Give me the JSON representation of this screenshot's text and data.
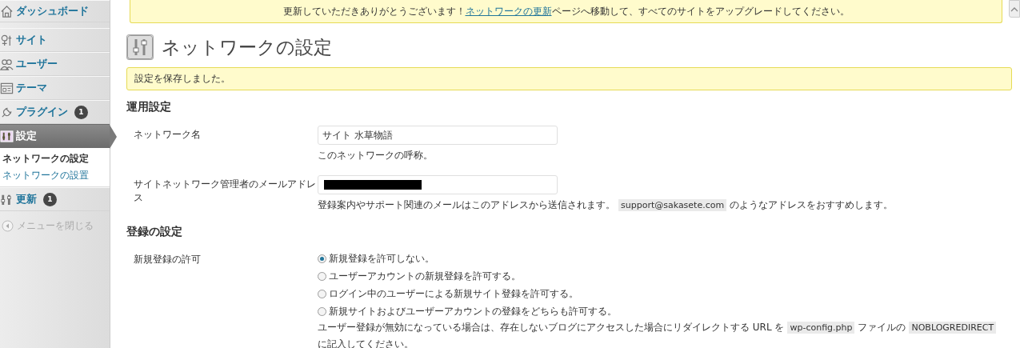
{
  "sidebar": {
    "items": [
      {
        "label": "ダッシュボード",
        "selected": false
      },
      {
        "label": "サイト",
        "selected": false
      },
      {
        "label": "ユーザー",
        "selected": false
      },
      {
        "label": "テーマ",
        "selected": false
      },
      {
        "label": "プラグイン",
        "selected": false,
        "badge": "1"
      },
      {
        "label": "設定",
        "selected": true,
        "children": [
          {
            "label": "ネットワークの設定",
            "selected": true
          },
          {
            "label": "ネットワークの設置",
            "selected": false
          }
        ]
      },
      {
        "label": "更新",
        "selected": false,
        "badge": "1"
      }
    ],
    "collapse": "メニューを閉じる"
  },
  "update_notice": {
    "before": "更新していただきありがとうございます！",
    "link": "ネットワークの更新",
    "after": "ページへ移動して、すべてのサイトをアップグレードしてください。"
  },
  "page_title": "ネットワークの設定",
  "saved_notice": "設定を保存しました。",
  "sections": [
    {
      "heading": "運用設定",
      "rows": [
        {
          "kind": "text",
          "label": "ネットワーク名",
          "value": "サイト 水草物語",
          "description": [
            {
              "kind": "text",
              "text": "このネットワークの呼称。"
            }
          ]
        },
        {
          "kind": "redacted",
          "label": "サイトネットワーク管理者のメールアドレス",
          "description": [
            {
              "kind": "text",
              "text": "登録案内やサポート関連のメールはこのアドレスから送信されます。"
            },
            {
              "kind": "code",
              "text": "support@sakasete.com"
            },
            {
              "kind": "text",
              "text": "のようなアドレスをおすすめします。"
            }
          ]
        }
      ]
    },
    {
      "heading": "登録の設定",
      "rows": [
        {
          "kind": "radio",
          "label": "新規登録の許可",
          "options": [
            {
              "label": "新規登録を許可しない。",
              "selected": true
            },
            {
              "label": "ユーザーアカウントの新規登録を許可する。",
              "selected": false
            },
            {
              "label": "ログイン中のユーザーによる新規サイト登録を許可する。",
              "selected": false
            },
            {
              "label": "新規サイトおよびユーザーアカウントの登録をどちらも許可する。",
              "selected": false
            }
          ],
          "description": [
            {
              "kind": "text",
              "text": "ユーザー登録が無効になっている場合は、存在しないブログにアクセスした場合にリダイレクトする URL を"
            },
            {
              "kind": "code",
              "text": "wp-config.php"
            },
            {
              "kind": "text",
              "text": "ファイルの"
            },
            {
              "kind": "code",
              "text": "NOBLOGREDIRECT"
            },
            {
              "kind": "text",
              "text": "に記入してください。"
            }
          ]
        }
      ]
    }
  ]
}
